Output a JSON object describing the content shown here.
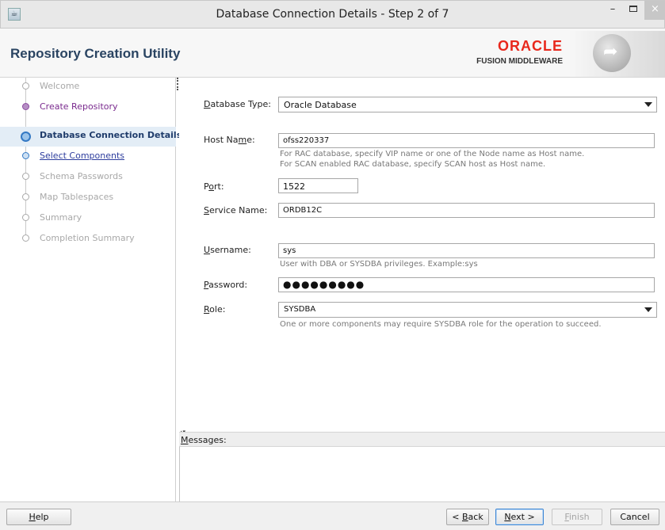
{
  "window": {
    "title": "Database Connection Details - Step 2 of 7",
    "minimize_glyph": "–",
    "close_glyph": "×"
  },
  "header": {
    "app_title": "Repository Creation Utility",
    "brand_word": "ORACLE",
    "brand_sub": "FUSION MIDDLEWARE",
    "accent_color": "#e8281c"
  },
  "nav": {
    "items": [
      {
        "label": "Welcome",
        "state": "disabled"
      },
      {
        "label": "Create Repository",
        "state": "visited"
      },
      {
        "label": "Database Connection Details",
        "state": "current"
      },
      {
        "label": "Select Components",
        "state": "link"
      },
      {
        "label": "Schema Passwords",
        "state": "disabled"
      },
      {
        "label": "Map Tablespaces",
        "state": "disabled"
      },
      {
        "label": "Summary",
        "state": "disabled"
      },
      {
        "label": "Completion Summary",
        "state": "disabled"
      }
    ]
  },
  "form": {
    "database_type": {
      "label_pre": "",
      "label_mn": "D",
      "label_post": "atabase Type:",
      "value": "Oracle Database"
    },
    "host_name": {
      "label_pre": "Host Na",
      "label_mn": "m",
      "label_post": "e:",
      "value": "ofss220337",
      "hint1": "For RAC database, specify VIP name or one of the Node name as Host name.",
      "hint2": "For SCAN enabled RAC database, specify SCAN host as Host name."
    },
    "port": {
      "label_pre": "P",
      "label_mn": "o",
      "label_post": "rt:",
      "value": "1522"
    },
    "service_name": {
      "label_pre": "",
      "label_mn": "S",
      "label_post": "ervice Name:",
      "value": "ORDB12C"
    },
    "username": {
      "label_pre": "",
      "label_mn": "U",
      "label_post": "sername:",
      "value": "sys",
      "hint": "User with DBA or SYSDBA privileges. Example:sys"
    },
    "password": {
      "label_pre": "",
      "label_mn": "P",
      "label_post": "assword:",
      "value": "●●●●●●●●●"
    },
    "role": {
      "label_pre": "",
      "label_mn": "R",
      "label_post": "ole:",
      "value": "SYSDBA",
      "hint": "One or more components may require SYSDBA role for the operation to succeed."
    }
  },
  "messages": {
    "label_pre": "",
    "label_mn": "M",
    "label_post": "essages:"
  },
  "buttons": {
    "help": {
      "pre": "",
      "mn": "H",
      "post": "elp"
    },
    "back": {
      "pre": "< ",
      "mn": "B",
      "post": "ack"
    },
    "next": {
      "pre": "",
      "mn": "N",
      "post": "ext >"
    },
    "finish": {
      "pre": "",
      "mn": "F",
      "post": "inish"
    },
    "cancel": {
      "pre": "Cancel",
      "mn": "",
      "post": ""
    }
  }
}
